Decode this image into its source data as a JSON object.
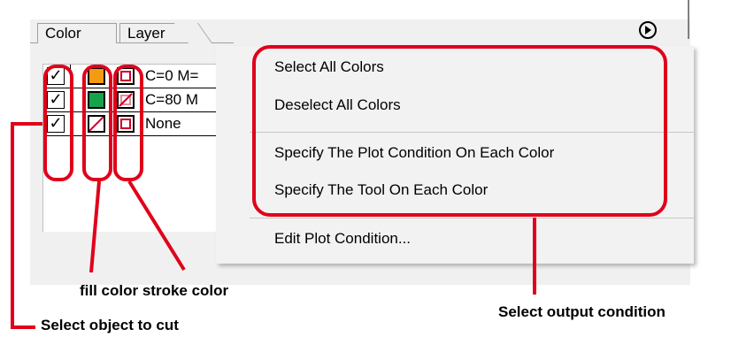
{
  "tabs": [
    {
      "label": "Color",
      "active": true
    },
    {
      "label": "Layer",
      "active": false
    }
  ],
  "color_rows": [
    {
      "checked": true,
      "check_glyph": "✓",
      "fill_color": "#f39c12",
      "fill_none": false,
      "stroke_none": false,
      "label": "C=0 M="
    },
    {
      "checked": true,
      "check_glyph": "✓",
      "fill_color": "#16a34a",
      "fill_none": false,
      "stroke_none": true,
      "label": "C=80 M"
    },
    {
      "checked": true,
      "check_glyph": "✓",
      "fill_color": "#ffffff",
      "fill_none": true,
      "stroke_none": false,
      "label": "None"
    }
  ],
  "context_menu": {
    "items": [
      {
        "label": "Select All Colors"
      },
      {
        "label": "Deselect All Colors"
      },
      {
        "label": "Specify The Plot Condition On Each Color"
      },
      {
        "label": "Specify The Tool On Each Color"
      },
      {
        "label": "Edit Plot Condition..."
      }
    ]
  },
  "annotations": {
    "fill_stroke": "fill color stroke color",
    "select_object": "Select object to cut",
    "select_output": "Select output condition"
  },
  "colors": {
    "highlight": "#e0001a",
    "stroke_red": "#d0002a"
  },
  "icons": {
    "panel_menu": "circle-play-icon"
  }
}
